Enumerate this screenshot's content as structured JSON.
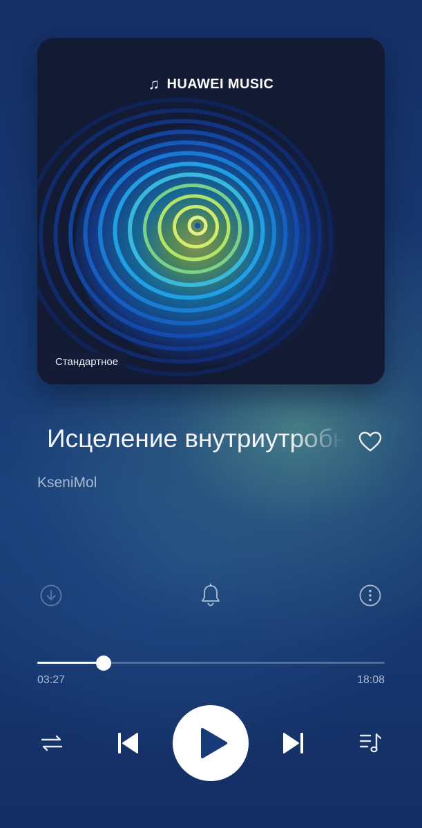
{
  "album": {
    "brand": "HUAWEI MUSIC",
    "brand_icon": "music-note-icon",
    "quality_badge": "Стандартное"
  },
  "track": {
    "title": "Исцеление внутриутробного",
    "title_visible": "Исцеление внутриутр",
    "artist": "KseniMol",
    "liked": false
  },
  "actions": {
    "download_icon": "download-icon",
    "ringtone_icon": "bell-icon",
    "more_icon": "more-vertical-icon"
  },
  "playback": {
    "elapsed": "03:27",
    "total": "18:08",
    "progress_fraction": 0.191,
    "state": "paused"
  },
  "controls": {
    "shuffle_icon": "repeat-shuffle-icon",
    "prev_icon": "skip-previous-icon",
    "play_icon": "play-icon",
    "next_icon": "skip-next-icon",
    "queue_icon": "playlist-icon"
  },
  "colors": {
    "accent": "#ffffff",
    "play_icon": "#173a78",
    "background_top": "#152f66",
    "background_glow": "#5a968c"
  }
}
